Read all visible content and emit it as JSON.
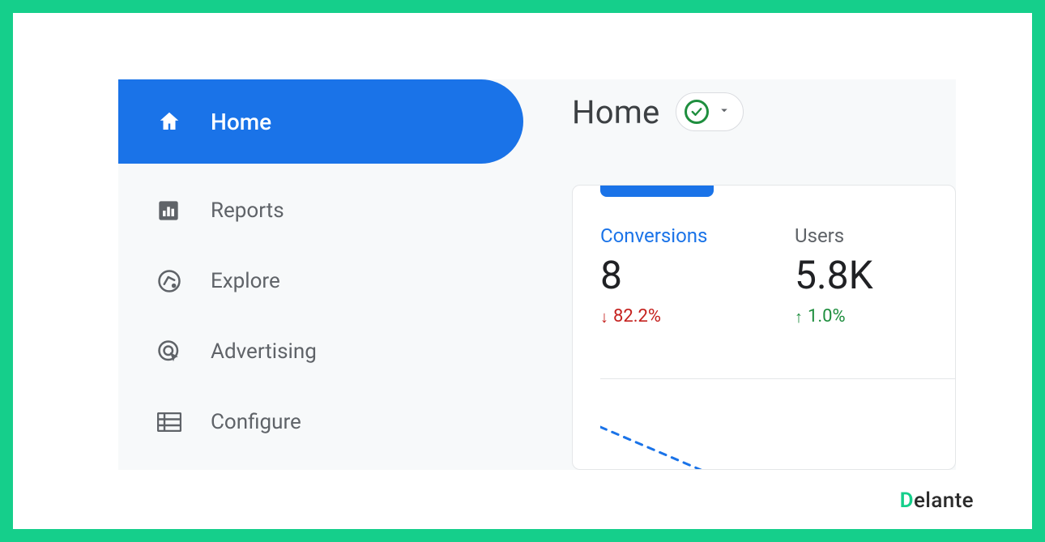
{
  "sidebar": {
    "items": [
      {
        "label": "Home"
      },
      {
        "label": "Reports"
      },
      {
        "label": "Explore"
      },
      {
        "label": "Advertising"
      },
      {
        "label": "Configure"
      }
    ]
  },
  "header": {
    "title": "Home"
  },
  "metrics": {
    "conversions": {
      "label": "Conversions",
      "value": "8",
      "delta": "82.2%"
    },
    "users": {
      "label": "Users",
      "value": "5.8K",
      "delta": "1.0%"
    }
  },
  "brand": {
    "first": "D",
    "rest": "elante"
  },
  "colors": {
    "accent": "#1a73e8",
    "brandGreen": "#15cf8b",
    "up": "#1e8e3e",
    "down": "#c5221f"
  }
}
